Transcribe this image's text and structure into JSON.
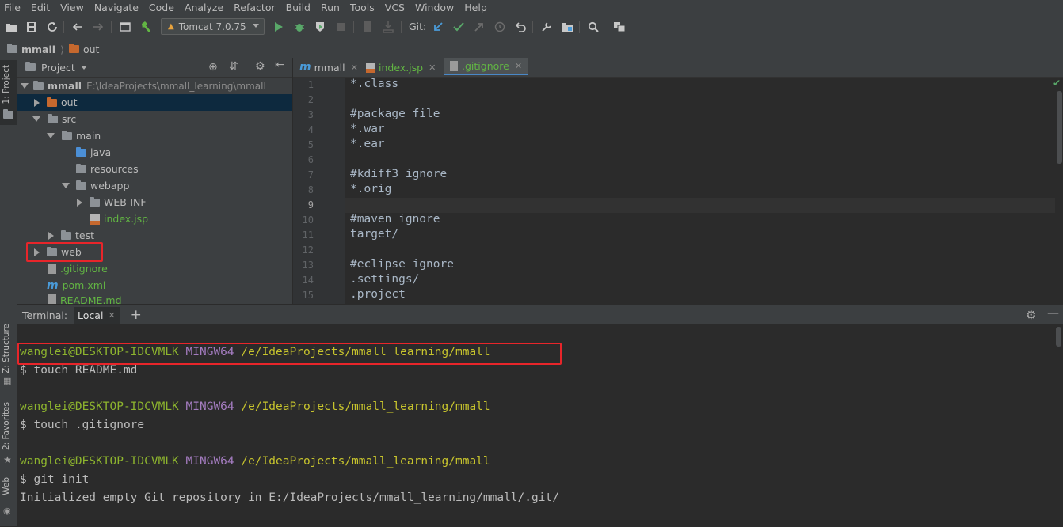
{
  "menu": [
    "File",
    "Edit",
    "View",
    "Navigate",
    "Code",
    "Analyze",
    "Refactor",
    "Build",
    "Run",
    "Tools",
    "VCS",
    "Window",
    "Help"
  ],
  "toolbar": {
    "run_config": "Tomcat 7.0.75",
    "git_label": "Git:"
  },
  "breadcrumb": {
    "project": "mmall",
    "folder": "out"
  },
  "left_stripe": {
    "project_tab": "1: Project",
    "structure_tab": "Z: Structure",
    "favorites_tab": "2: Favorites",
    "web_tab": "Web"
  },
  "project_panel": {
    "title": "Project",
    "tree": [
      {
        "label": "mmall",
        "path": "E:\\IdeaProjects\\mmall_learning\\mmall"
      },
      {
        "label": "out"
      },
      {
        "label": "src"
      },
      {
        "label": "main"
      },
      {
        "label": "java"
      },
      {
        "label": "resources"
      },
      {
        "label": "webapp"
      },
      {
        "label": "WEB-INF"
      },
      {
        "label": "index.jsp"
      },
      {
        "label": "test"
      },
      {
        "label": "web"
      },
      {
        "label": ".gitignore"
      },
      {
        "label": "pom.xml"
      },
      {
        "label": "README.md"
      }
    ]
  },
  "editor": {
    "tabs": [
      {
        "label": "mmall"
      },
      {
        "label": "index.jsp"
      },
      {
        "label": ".gitignore"
      }
    ],
    "line_numbers": [
      "1",
      "2",
      "3",
      "4",
      "5",
      "6",
      "7",
      "8",
      "9",
      "10",
      "11",
      "12",
      "13",
      "14",
      "15"
    ],
    "lines": [
      "*.class",
      "",
      "#package file",
      "*.war",
      "*.ear",
      "",
      "#kdiff3 ignore",
      "*.orig",
      "",
      "#maven ignore",
      "target/",
      "",
      "#eclipse ignore",
      ".settings/",
      ".project"
    ]
  },
  "terminal": {
    "label": "Terminal:",
    "tab": "Local",
    "prompt_user": "wanglei@DESKTOP-IDCVMLK",
    "prompt_host": "MINGW64",
    "prompt_path": "/e/IdeaProjects/mmall_learning/mmall",
    "cmd1": "$ touch README.md",
    "cmd2": "$ touch .gitignore",
    "cmd3": "$ git init",
    "output": "Initialized empty Git repository in E:/IdeaProjects/mmall_learning/mmall/.git/"
  },
  "colors": {
    "background": "#2b2b2b",
    "panel": "#3c3f41",
    "selection": "#0d293e",
    "highlight_box": "#e8252a",
    "prompt_user": "#8db42e",
    "prompt_host": "#a47cc0",
    "prompt_path": "#c7c42d"
  }
}
